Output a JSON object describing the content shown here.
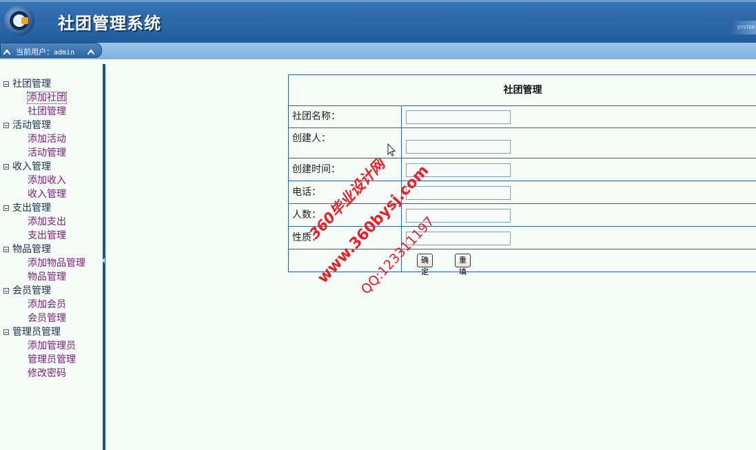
{
  "app": {
    "title": "社团管理系统",
    "sys_mark": "SYSTEM"
  },
  "userbar": {
    "label": "当前用户：",
    "username": "admin"
  },
  "sidebar": {
    "groups": [
      {
        "label": "社团管理",
        "items": [
          "添加社团",
          "社团管理"
        ]
      },
      {
        "label": "活动管理",
        "items": [
          "添加活动",
          "活动管理"
        ]
      },
      {
        "label": "收入管理",
        "items": [
          "添加收入",
          "收入管理"
        ]
      },
      {
        "label": "支出管理",
        "items": [
          "添加支出",
          "支出管理"
        ]
      },
      {
        "label": "物品管理",
        "items": [
          "添加物品管理",
          "物品管理"
        ]
      },
      {
        "label": "会员管理",
        "items": [
          "添加会员",
          "会员管理"
        ]
      },
      {
        "label": "管理员管理",
        "items": [
          "添加管理员",
          "管理员管理",
          "修改密码"
        ]
      }
    ],
    "active_item": "添加社团"
  },
  "form": {
    "title": "社团管理",
    "fields": [
      {
        "label": "社团名称：",
        "value": ""
      },
      {
        "label": "创建人：",
        "value": ""
      },
      {
        "label": "创建时间：",
        "value": ""
      },
      {
        "label": "电话：",
        "value": ""
      },
      {
        "label": "人数：",
        "value": ""
      },
      {
        "label": "性质：",
        "value": ""
      }
    ],
    "submit_label": "确定",
    "reset_label": "重填"
  },
  "watermark": {
    "line1": "360毕业设计网",
    "line2": "www.360bysj.com",
    "line3": "QQ:123311197",
    "color": "#e8202a"
  },
  "colors": {
    "header": "#2c67a8",
    "border": "#2b5f97",
    "link": "#7a1e7a"
  }
}
